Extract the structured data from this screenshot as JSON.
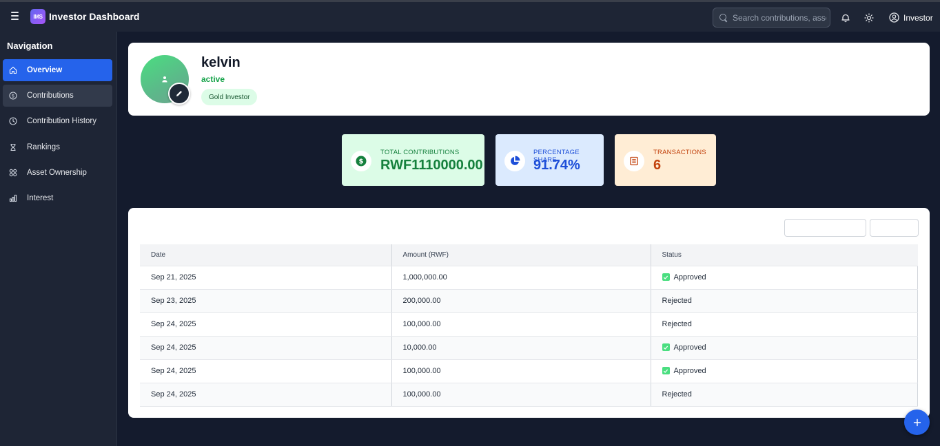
{
  "header": {
    "logo_text": "IMS",
    "title": "Investor Dashboard",
    "search_placeholder": "Search contributions, assets...",
    "user_label": "Investor"
  },
  "sidebar": {
    "title": "Navigation",
    "items": [
      {
        "label": "Overview",
        "icon": "home-icon",
        "active": true
      },
      {
        "label": "Contributions",
        "icon": "dollar-circle-icon"
      },
      {
        "label": "Contribution History",
        "icon": "clock-icon"
      },
      {
        "label": "Rankings",
        "icon": "hourglass-icon"
      },
      {
        "label": "Asset Ownership",
        "icon": "grid-icon"
      },
      {
        "label": "Interest",
        "icon": "bar-chart-icon"
      }
    ]
  },
  "profile": {
    "name": "kelvin",
    "status": "active",
    "badge": "Gold Investor"
  },
  "stats": [
    {
      "label": "TOTAL CONTRIBUTIONS",
      "value": "RWF1110000.00",
      "icon": "dollar-icon",
      "color": "#15803d"
    },
    {
      "label": "PERCENTAGE SHARE",
      "value": "91.74%",
      "icon": "pie-chart-icon",
      "color": "#1d4ed8"
    },
    {
      "label": "TRANSACTIONS",
      "value": "6",
      "icon": "receipt-icon",
      "color": "#c2410c"
    }
  ],
  "table": {
    "columns": [
      "Date",
      "Amount (RWF)",
      "Status"
    ],
    "rows": [
      {
        "date": "Sep 21, 2025",
        "amount": "1,000,000.00",
        "status": "Approved"
      },
      {
        "date": "Sep 23, 2025",
        "amount": "200,000.00",
        "status": "Rejected"
      },
      {
        "date": "Sep 24, 2025",
        "amount": "100,000.00",
        "status": "Rejected"
      },
      {
        "date": "Sep 24, 2025",
        "amount": "10,000.00",
        "status": "Approved"
      },
      {
        "date": "Sep 24, 2025",
        "amount": "100,000.00",
        "status": "Approved"
      },
      {
        "date": "Sep 24, 2025",
        "amount": "100,000.00",
        "status": "Rejected"
      }
    ]
  },
  "colors": {
    "accent": "#2563eb",
    "approved": "#4ade80",
    "active_status": "#16a34a"
  }
}
